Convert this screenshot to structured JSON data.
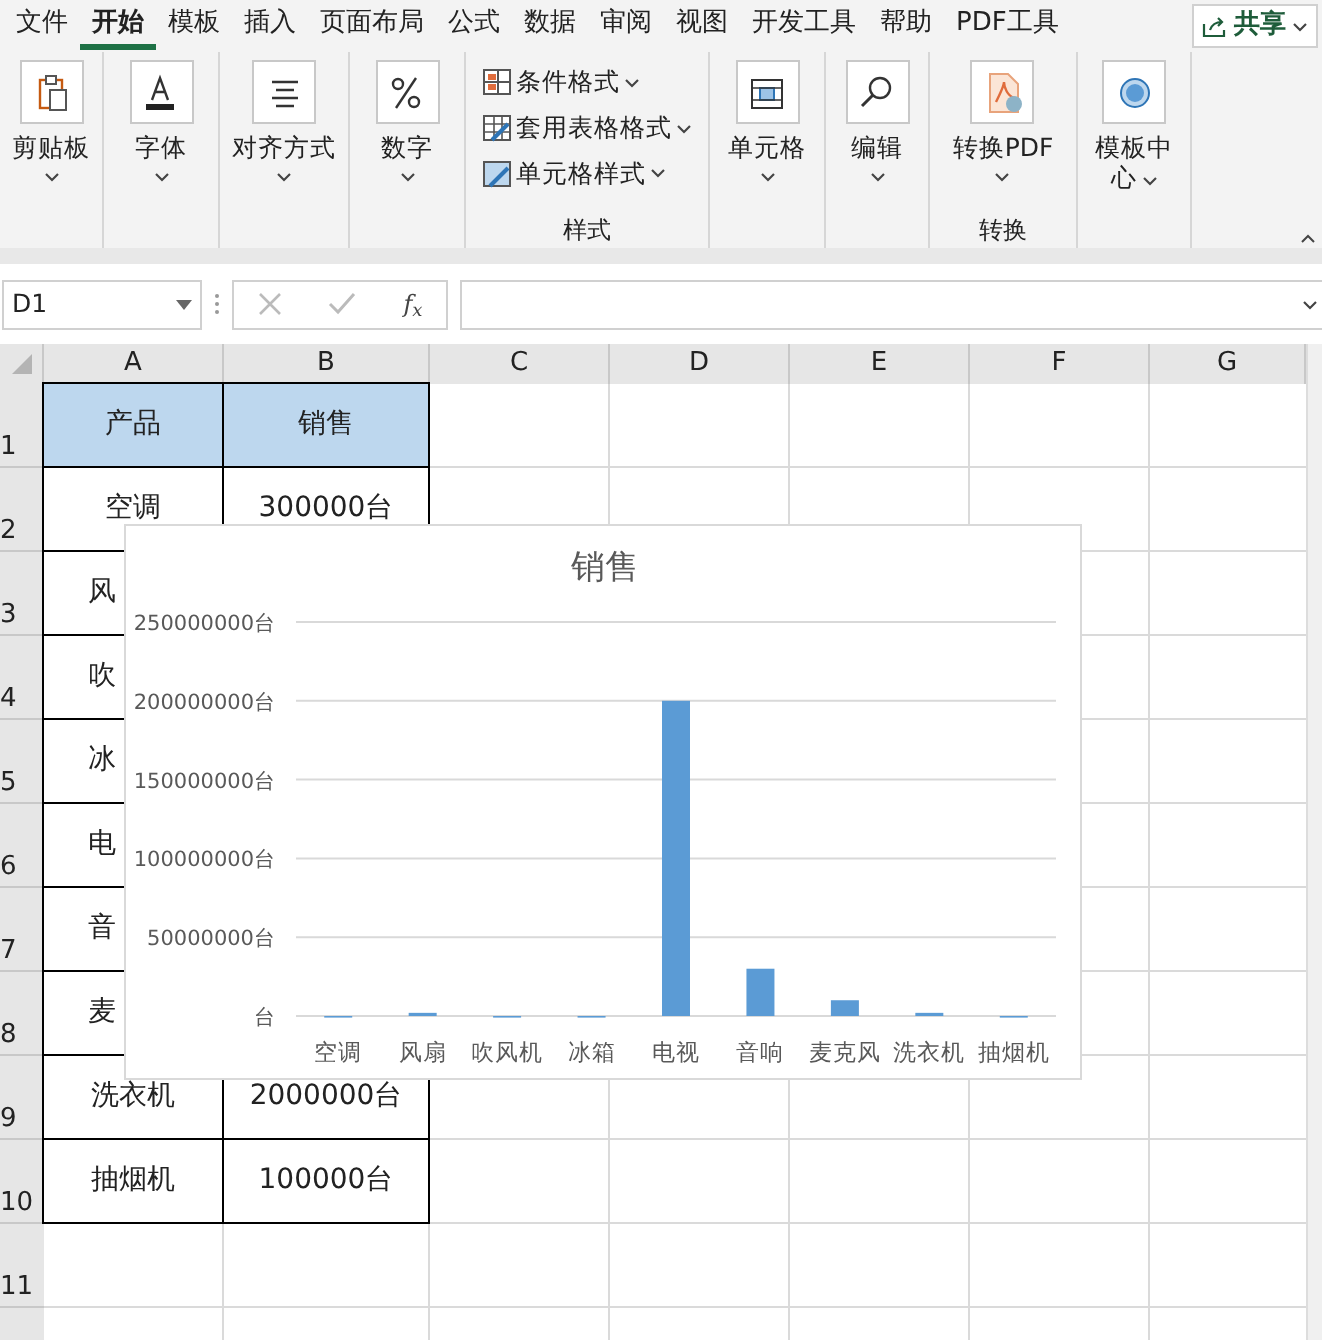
{
  "tabs": [
    {
      "label": "文件",
      "selected": false
    },
    {
      "label": "开始",
      "selected": true
    },
    {
      "label": "模板",
      "selected": false
    },
    {
      "label": "插入",
      "selected": false
    },
    {
      "label": "页面布局",
      "selected": false
    },
    {
      "label": "公式",
      "selected": false
    },
    {
      "label": "数据",
      "selected": false
    },
    {
      "label": "审阅",
      "selected": false
    },
    {
      "label": "视图",
      "selected": false
    },
    {
      "label": "开发工具",
      "selected": false
    },
    {
      "label": "帮助",
      "selected": false
    },
    {
      "label": "PDF工具",
      "selected": false
    }
  ],
  "share_button": {
    "label": "共享"
  },
  "ribbon": {
    "groups": [
      {
        "buttons": [
          {
            "kind": "large",
            "label": "剪贴板"
          }
        ]
      },
      {
        "buttons": [
          {
            "kind": "large",
            "label": "字体"
          }
        ]
      },
      {
        "buttons": [
          {
            "kind": "large",
            "label": "对齐方式"
          }
        ]
      },
      {
        "buttons": [
          {
            "kind": "large",
            "label": "数字"
          }
        ]
      },
      {
        "label": "样式",
        "buttons": [
          {
            "kind": "small",
            "label": "条件格式"
          },
          {
            "kind": "small",
            "label": "套用表格格式"
          },
          {
            "kind": "small",
            "label": "单元格样式"
          }
        ]
      },
      {
        "buttons": [
          {
            "kind": "large",
            "label": "单元格"
          }
        ]
      },
      {
        "buttons": [
          {
            "kind": "large",
            "label": "编辑"
          }
        ]
      },
      {
        "label": "转换",
        "buttons": [
          {
            "kind": "large",
            "label": "转换PDF"
          }
        ]
      },
      {
        "buttons": [
          {
            "kind": "large",
            "label": "模板中心"
          }
        ]
      }
    ]
  },
  "formula_bar": {
    "name_box": "D1",
    "function_label": "f$_{x}$"
  },
  "sheet": {
    "columns": [
      "A",
      "B",
      "C",
      "D",
      "E",
      "F",
      "G"
    ],
    "row_headers": [
      "1",
      "2",
      "3",
      "4",
      "5",
      "6",
      "7",
      "8",
      "9",
      "10",
      "11"
    ],
    "rows": [
      {
        "kind": "header",
        "a": "产品",
        "b": "销售"
      },
      {
        "kind": "data",
        "a": "空调",
        "b": "300000台"
      },
      {
        "kind": "data",
        "a": "风"
      },
      {
        "kind": "data",
        "a": "吹"
      },
      {
        "kind": "data",
        "a": "冰"
      },
      {
        "kind": "data",
        "a": "电"
      },
      {
        "kind": "data",
        "a": "音"
      },
      {
        "kind": "data",
        "a": "麦"
      },
      {
        "kind": "data",
        "a": "洗衣机",
        "b": "2000000台"
      },
      {
        "kind": "data",
        "a": "抽烟机",
        "b": "100000台"
      }
    ]
  },
  "chart": {
    "chart_data": {
      "type": "bar",
      "title": "销售",
      "categories": [
        "空调",
        "风扇",
        "吹风机",
        "冰箱",
        "电视",
        "音响",
        "麦克风",
        "洗衣机",
        "抽烟机"
      ],
      "series": [
        {
          "color": "#5b9bd5",
          "values": [
            0,
            2000000,
            0,
            0,
            200000000,
            30000000,
            10000000,
            2000000,
            0
          ]
        }
      ],
      "grid": true,
      "ylim": [
        0,
        250000000
      ],
      "yticks": [
        {
          "value": 0,
          "label": "台"
        },
        {
          "value": 50000000,
          "label": "50000000台"
        },
        {
          "value": 100000000,
          "label": "100000000台"
        },
        {
          "value": 150000000,
          "label": "150000000台"
        },
        {
          "value": 200000000,
          "label": "200000000台"
        },
        {
          "value": 250000000,
          "label": "250000000台"
        }
      ]
    }
  }
}
